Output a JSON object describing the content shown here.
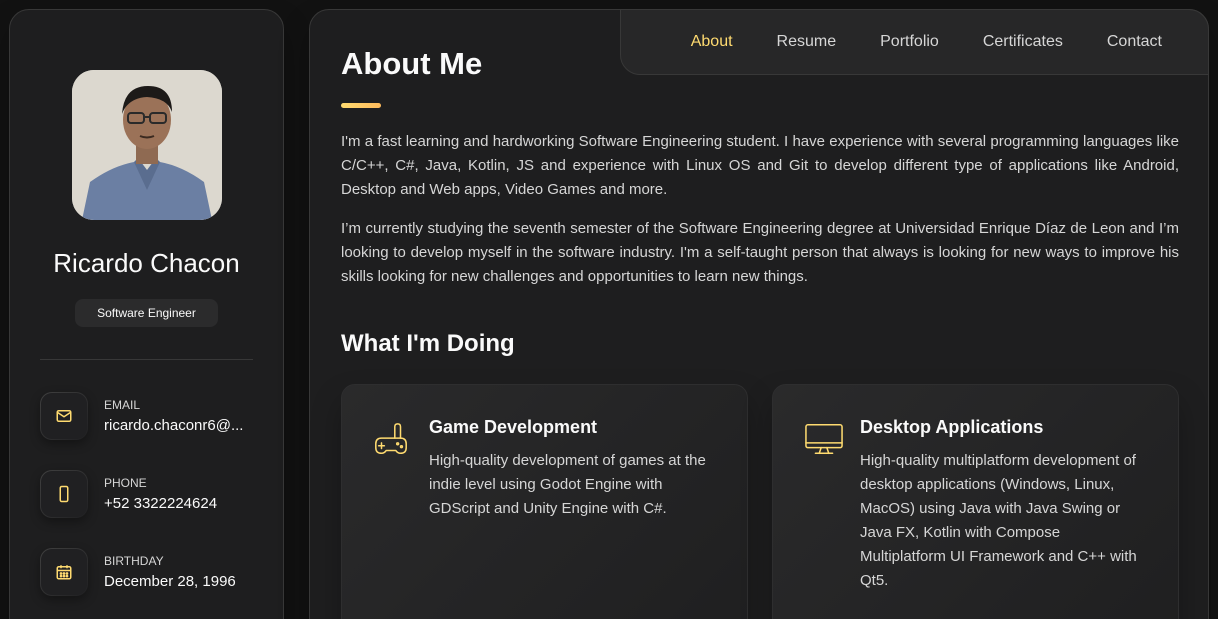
{
  "profile": {
    "name": "Ricardo Chacon",
    "title": "Software Engineer"
  },
  "contacts": [
    {
      "label": "EMAIL",
      "value": "ricardo.chaconr6@...",
      "icon": "mail-icon"
    },
    {
      "label": "PHONE",
      "value": "+52 3322224624",
      "icon": "phone-icon"
    },
    {
      "label": "BIRTHDAY",
      "value": "December 28, 1996",
      "icon": "calendar-icon"
    }
  ],
  "nav": {
    "items": [
      "About",
      "Resume",
      "Portfolio",
      "Certificates",
      "Contact"
    ],
    "active": "About"
  },
  "about": {
    "heading": "About Me",
    "paragraphs": [
      "I'm a fast learning and hardworking Software Engineering student. I have experience with several programming languages like C/C++, C#, Java, Kotlin, JS and experience with Linux OS and Git to develop different type of applications like Android, Desktop and Web apps, Video Games and more.",
      "I’m currently studying the seventh semester of the Software Engineering degree at Universidad Enrique Díaz de Leon and I’m looking to develop myself in the software industry. I'm a self-taught person that always is looking for new ways to improve his skills looking for new challenges and opportunities to learn new things."
    ]
  },
  "doing": {
    "heading": "What I'm Doing",
    "services": [
      {
        "title": "Game Development",
        "text": "High-quality development of games at the indie level using Godot Engine with GDScript and Unity Engine with C#.",
        "icon": "gamepad-icon"
      },
      {
        "title": "Desktop Applications",
        "text": "High-quality multiplatform development of desktop applications (Windows, Linux, MacOS) using Java with Java Swing or Java FX, Kotlin with Compose Multiplatform UI Framework and C++ with Qt5.",
        "icon": "monitor-icon"
      }
    ]
  },
  "colors": {
    "accent": "#ffdb70",
    "background": "#121212",
    "card": "#1e1e1f"
  }
}
